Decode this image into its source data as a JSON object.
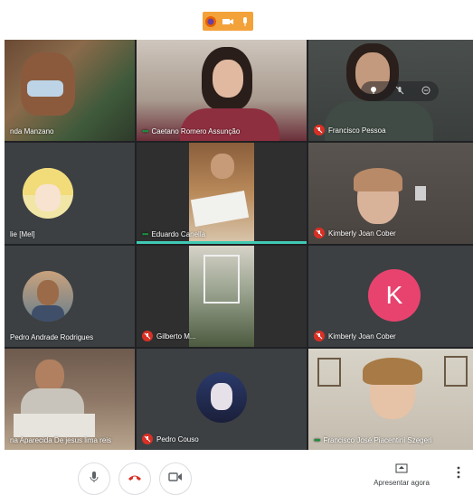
{
  "browser_bar": {
    "icons": [
      "firefox-icon",
      "camera-icon",
      "microphone-icon"
    ],
    "color": "#f3a23a"
  },
  "participants": [
    {
      "name": "nda Manzano",
      "status": "none"
    },
    {
      "name": "Caetano Romero Assunção",
      "status": "speaking"
    },
    {
      "name": "Francisco Pessoa",
      "status": "muted"
    },
    {
      "name": "lie [Mel]",
      "status": "none"
    },
    {
      "name": "Eduardo Canella",
      "status": "speaking",
      "active": true
    },
    {
      "name": "Kimberly Joan Cober",
      "status": "muted"
    },
    {
      "name": "Pedro Andrade Rodrigues",
      "status": "none"
    },
    {
      "name": "Gilberto M...",
      "status": "muted"
    },
    {
      "name": "Kimberly Joan Cober",
      "status": "muted",
      "avatar_letter": "K"
    },
    {
      "name": "na Aparecida De jesus lima reis",
      "status": "none"
    },
    {
      "name": "Pedro Couso",
      "status": "muted"
    },
    {
      "name": "Francisco José Piacentini Szegeri",
      "status": "speaking"
    }
  ],
  "controls": {
    "mic_icon": "microphone-icon",
    "hangup_icon": "hangup-icon",
    "camera_icon": "camera-icon",
    "present_label": "Apresentar agora",
    "present_icon": "present-screen-icon",
    "more_icon": "more-vert-icon"
  },
  "colors": {
    "hangup": "#d93025",
    "active_speaker": "#40c9b3",
    "avatar_k": "#e8436f"
  }
}
